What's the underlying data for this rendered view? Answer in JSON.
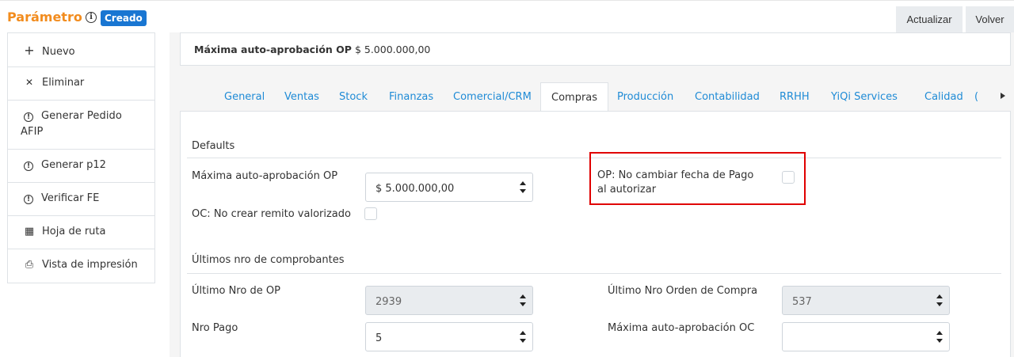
{
  "header": {
    "title": "Parámetro",
    "info_icon": "i",
    "status": "Creado",
    "actions": [
      "Actualizar",
      "Volver"
    ]
  },
  "sidebar": {
    "items": [
      {
        "icon": "plus-icon",
        "glyph": "+",
        "label": "Nuevo"
      },
      {
        "icon": "x-icon",
        "glyph": "✕",
        "label": "Eliminar"
      },
      {
        "icon": "alert-icon",
        "glyph": "!",
        "label": "Generar Pedido AFIP"
      },
      {
        "icon": "alert-icon",
        "glyph": "!",
        "label": "Generar p12"
      },
      {
        "icon": "alert-icon",
        "glyph": "!",
        "label": "Verificar FE"
      },
      {
        "icon": "calendar-icon",
        "glyph": "▦",
        "label": "Hoja de ruta"
      },
      {
        "icon": "printer-icon",
        "glyph": "⎙",
        "label": "Vista de impresión"
      }
    ]
  },
  "summary": {
    "label": "Máxima auto-aprobación OP",
    "value": "$ 5.000.000,00"
  },
  "tabs": {
    "items": [
      "General",
      "Ventas",
      "Stock",
      "Finanzas",
      "Comercial/CRM",
      "Compras",
      "Producción",
      "Contabilidad",
      "RRHH",
      "YiQi Services",
      "Calidad",
      "("
    ],
    "active": "Compras"
  },
  "form": {
    "defaults_title": "Defaults",
    "max_auto_op_label": "Máxima auto-aprobación OP",
    "max_auto_op_value": "$ 5.000.000,00",
    "op_no_cambiar_label_1": "OP: No cambiar fecha de Pago",
    "op_no_cambiar_label_2": "al autorizar",
    "oc_no_crear_label": "OC: No crear remito valorizado",
    "ultimos_title": "Últimos nro de comprobantes",
    "ultimo_op_label": "Último Nro de OP",
    "ultimo_op_value": "2939",
    "ultimo_oc_label": "Último Nro Orden de Compra",
    "ultimo_oc_value": "537",
    "nro_pago_label": "Nro Pago",
    "nro_pago_value": "5",
    "max_auto_oc_label": "Máxima auto-aprobación OC",
    "max_auto_oc_value": ""
  },
  "colors": {
    "title": "#f28c1e",
    "badge": "#1976d2",
    "tab_link": "#1f8bd6",
    "highlight": "#e00000"
  }
}
